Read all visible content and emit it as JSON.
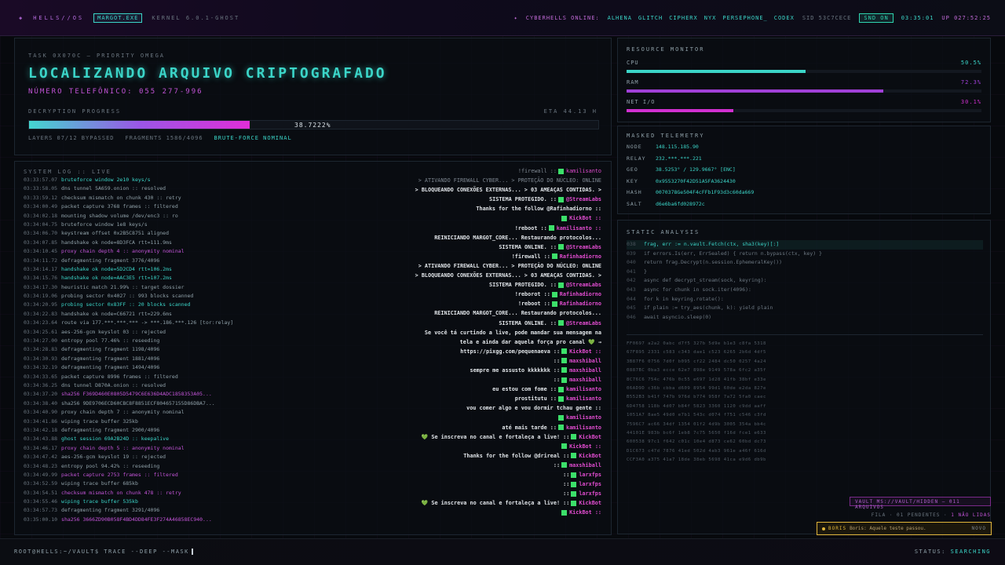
{
  "topbar": {
    "brand": "HELLS//OS",
    "proc": "MARGOT.EXE",
    "kernel": "KERNEL 6.0.1-GHOST",
    "online_label": "CYBERHELLS ONLINE:",
    "users": [
      "ALHENA",
      "GLITCH",
      "CIPHERX",
      "NYX",
      "PERSEPHONE_",
      "CODEX"
    ],
    "sid": "SID 53C7CECE",
    "snd": "SND ON",
    "clock": "03:35:01",
    "uptime": "UP 027:52:25"
  },
  "task": {
    "id": "TASK 0X070C — PRIORITY OMEGA",
    "title": "LOCALIZANDO ARQUIVO CRIPTOGRAFADO",
    "phone": "NÚMERO TELEFÔNICO: 055 277-996",
    "progress_label": "DECRYPTION PROGRESS",
    "eta": "ETA 44.13 H",
    "progress_pct": 38.7222,
    "progress_text": "38.7222%",
    "layers": "LAYERS 07/12 BYPASSED",
    "fragments": "FRAGMENTS 1586/4096",
    "bruteforce": "BRUTE-FORCE NOMINAL"
  },
  "log": {
    "title": "SYSTEM LOG :: LIVE",
    "lines": [
      {
        "t": "03:33:57.07",
        "m": "bruteforce window 2e10 keys/s",
        "c": "c"
      },
      {
        "t": "03:33:58.05",
        "m": "dns tunnel 5A659.onion :: resolved",
        "c": ""
      },
      {
        "t": "03:33:59.12",
        "m": "checksum mismatch on chunk 430 :: retry",
        "c": ""
      },
      {
        "t": "03:34:00.49",
        "m": "packet capture 3768 frames :: filtered",
        "c": ""
      },
      {
        "t": "03:34:02.18",
        "m": "mounting shadow volume /dev/enc3 :: ro",
        "c": ""
      },
      {
        "t": "03:34:04.75",
        "m": "bruteforce window 1e8 keys/s",
        "c": ""
      },
      {
        "t": "03:34:06.70",
        "m": "keystream offset 0x2B5C8751 aligned",
        "c": ""
      },
      {
        "t": "03:34:07.85",
        "m": "handshake ok node=8D3FCA rtt=111.9ms",
        "c": ""
      },
      {
        "t": "03:34:10.45",
        "m": "proxy chain depth 4 :: anonymity nominal",
        "c": "m"
      },
      {
        "t": "03:34:11.72",
        "m": "defragmenting fragment 3776/4096",
        "c": ""
      },
      {
        "t": "03:34:14.17",
        "m": "handshake ok node=5D2CD4 rtt=106.2ms",
        "c": "c"
      },
      {
        "t": "03:34:15.76",
        "m": "handshake ok node=AAC3E5 rtt=107.2ms",
        "c": "c"
      },
      {
        "t": "03:34:17.30",
        "m": "heuristic match 21.99% :: target dossier",
        "c": ""
      },
      {
        "t": "03:34:19.06",
        "m": "probing sector 0x4027 :: 993 blocks scanned",
        "c": ""
      },
      {
        "t": "03:34:20.95",
        "m": "probing sector 0x83FF :: 20 blocks scanned",
        "c": "c"
      },
      {
        "t": "03:34:22.83",
        "m": "handshake ok node=C66721 rtt=229.6ms",
        "c": ""
      },
      {
        "t": "03:34:23.64",
        "m": "route via 177.***.***.*** -> ***.186.***.126 [tor:relay]",
        "c": ""
      },
      {
        "t": "03:34:25.61",
        "m": "aes-256-gcm keyslot 03 :: rejected",
        "c": ""
      },
      {
        "t": "03:34:27.00",
        "m": "entropy pool 77.46% :: reseeding",
        "c": ""
      },
      {
        "t": "03:34:28.83",
        "m": "defragmenting fragment 1198/4096",
        "c": ""
      },
      {
        "t": "03:34:30.93",
        "m": "defragmenting fragment 1881/4096",
        "c": ""
      },
      {
        "t": "03:34:32.19",
        "m": "defragmenting fragment 1494/4096",
        "c": ""
      },
      {
        "t": "03:34:33.65",
        "m": "packet capture 8996 frames :: filtered",
        "c": ""
      },
      {
        "t": "03:34:36.25",
        "m": "dns tunnel D870A.onion :: resolved",
        "c": ""
      },
      {
        "t": "03:34:37.20",
        "m": "sha256 F369D460E0805D5479C6E636D4ADC1858353A05...",
        "c": "m"
      },
      {
        "t": "03:34:38.40",
        "m": "sha256 9DE9706ECD60CBC8F8851ECF804657155D86DBA7...",
        "c": ""
      },
      {
        "t": "03:34:40.90",
        "m": "proxy chain depth 7 :: anonymity nominal",
        "c": ""
      },
      {
        "t": "03:34:41.86",
        "m": "wiping trace buffer 325kb",
        "c": ""
      },
      {
        "t": "03:34:42.18",
        "m": "defragmenting fragment 2900/4096",
        "c": ""
      },
      {
        "t": "03:34:43.88",
        "m": "ghost session 69A2B24D :: keepalive",
        "c": "c"
      },
      {
        "t": "03:34:46.17",
        "m": "proxy chain depth 5 :: anonymity nominal",
        "c": "m"
      },
      {
        "t": "03:34:47.42",
        "m": "aes-256-gcm keyslot 19 :: rejected",
        "c": ""
      },
      {
        "t": "03:34:48.23",
        "m": "entropy pool 94.42% :: reseeding",
        "c": ""
      },
      {
        "t": "03:34:49.99",
        "m": "packet capture 2753 frames :: filtered",
        "c": "m"
      },
      {
        "t": "03:34:52.59",
        "m": "wiping trace buffer 685kb",
        "c": ""
      },
      {
        "t": "03:34:54.51",
        "m": "checksum mismatch on chunk 478 :: retry",
        "c": "m"
      },
      {
        "t": "03:34:55.46",
        "m": "wiping trace buffer 535kb",
        "c": "c"
      },
      {
        "t": "03:34:57.73",
        "m": "defragmenting fragment 3291/4096",
        "c": ""
      },
      {
        "t": "03:35:00.10",
        "m": "sha256 3666ZD90B058F4BD4DD84FE3F274A46858EC940...",
        "c": "m"
      }
    ]
  },
  "chat": [
    {
      "txt": "!firewall ::",
      "user": "kamilisanto",
      "cls": "dim"
    },
    {
      "txt": "> ATIVANDO FIREWALL CYBER... > PROTEÇÃO DO NÚCLEO: ONLINE",
      "user": "",
      "cls": "dim"
    },
    {
      "txt": "> BLOQUEANDO CONEXÕES EXTERNAS... > 03 AMEAÇAS CONTIDAS. >",
      "user": "",
      "cls": ""
    },
    {
      "txt": "SISTEMA PROTEGIDO. ::",
      "user": "@StreamLabs",
      "cls": ""
    },
    {
      "txt": "Thanks for the follow @Rafinhadiorno ::",
      "user": "",
      "cls": ""
    },
    {
      "txt": "",
      "user": "KickBot ::",
      "cls": ""
    },
    {
      "txt": "!reboot ::",
      "user": "kamilisanto ::",
      "cls": ""
    },
    {
      "txt": "REINICIANDO MARGOT_CORE... Restaurando protocolos...",
      "user": "",
      "cls": ""
    },
    {
      "txt": "SISTEMA ONLINE. ::",
      "user": "@StreamLabs",
      "cls": ""
    },
    {
      "txt": "!firewall ::",
      "user": "Rafinhadiorno",
      "cls": ""
    },
    {
      "txt": "> ATIVANDO FIREWALL CYBER... > PROTEÇÃO DO NÚCLEO: ONLINE",
      "user": "",
      "cls": ""
    },
    {
      "txt": "> BLOQUEANDO CONEXÕES EXTERNAS... > 03 AMEAÇAS CONTIDAS. >",
      "user": "",
      "cls": ""
    },
    {
      "txt": "SISTEMA PROTEGIDO. ::",
      "user": "@StreamLabs",
      "cls": ""
    },
    {
      "txt": "!reborot ::",
      "user": "Rafinhadiorno",
      "cls": ""
    },
    {
      "txt": "!reboot ::",
      "user": "Rafinhadiorno",
      "cls": ""
    },
    {
      "txt": "REINICIANDO MARGOT_CORE... Restaurando protocolos...",
      "user": "",
      "cls": ""
    },
    {
      "txt": "SISTEMA ONLINE. ::",
      "user": "@StreamLabs",
      "cls": ""
    },
    {
      "txt": "Se você tá curtindo a live, pode mandar sua mensagem na",
      "user": "",
      "cls": ""
    },
    {
      "txt": "tela e ainda dar aquela força pro canal 💚 →",
      "user": "",
      "cls": ""
    },
    {
      "txt": "https://pixgg.com/pequenaeva ::",
      "user": "KickBot ::",
      "cls": ""
    },
    {
      "txt": "::",
      "user": "maxshiball",
      "cls": ""
    },
    {
      "txt": "sempre me assusto kkkkkkk ::",
      "user": "maxshiball",
      "cls": ""
    },
    {
      "txt": "::",
      "user": "maxshiball",
      "cls": ""
    },
    {
      "txt": "eu estou com fome ::",
      "user": "kamilisanto",
      "cls": ""
    },
    {
      "txt": "prostitutu ::",
      "user": "kamilisanto",
      "cls": ""
    },
    {
      "txt": "vou comer algo e vou dormir tchau gente ::",
      "user": "",
      "cls": ""
    },
    {
      "txt": "",
      "user": "kamilisanto",
      "cls": ""
    },
    {
      "txt": "até mais tarde ::",
      "user": "kamilisanto",
      "cls": ""
    },
    {
      "txt": "💚 Se inscreva no canal e fortaleça a live! ::",
      "user": "KickBot",
      "cls": ""
    },
    {
      "txt": "",
      "user": "KickBot ::",
      "cls": ""
    },
    {
      "txt": "Thanks for the follow @drireal ::",
      "user": "KickBot",
      "cls": ""
    },
    {
      "txt": "::",
      "user": "maxshiball",
      "cls": ""
    },
    {
      "txt": "::",
      "user": "larxfps",
      "cls": ""
    },
    {
      "txt": "::",
      "user": "larxfps",
      "cls": ""
    },
    {
      "txt": "::",
      "user": "larxfps",
      "cls": ""
    },
    {
      "txt": "💚 Se inscreva no canal e fortaleça a live! ::",
      "user": "KickBot",
      "cls": ""
    },
    {
      "txt": "",
      "user": "KickBot ::",
      "cls": ""
    }
  ],
  "resource": {
    "title": "RESOURCE MONITOR",
    "cpu": {
      "label": "CPU",
      "value": "50.5%",
      "frac": 0.505,
      "color": "#3bd5c8"
    },
    "ram": {
      "label": "RAM",
      "value": "72.3%",
      "frac": 0.723,
      "color": "#a040d8"
    },
    "net": {
      "label": "NET I/O",
      "value": "30.1%",
      "frac": 0.301,
      "color": "#d030d0"
    }
  },
  "telemetry": {
    "title": "MASKED TELEMETRY",
    "rows": [
      [
        "NODE",
        "148.115.185.90"
      ],
      [
        "RELAY",
        "232.***.***.221"
      ],
      [
        "GEO",
        "38.5253° / 129.9667° [ENC]"
      ],
      [
        "KEY",
        "0x9553270F42D51A5FA3624430"
      ],
      [
        "HASH",
        "0070378Ge504F4cFFb1F93d3c60da669"
      ],
      [
        "SALT",
        "d6e6ba6fd028972c"
      ]
    ]
  },
  "static": {
    "title": "STATIC ANALYSIS",
    "code": [
      [
        "038",
        "frag, err := n.vault.Fetch(ctx, sha3(key)[:]"
      ],
      [
        "039",
        "if errors.Is(err, ErrSealed) { return n.bypass(ctx, key) }"
      ],
      [
        "040",
        "return frag.Decrypt(n.session.EphemeralKey())"
      ],
      [
        "041",
        "}"
      ],
      [
        "042",
        "async def decrypt_stream(sock, keyring):"
      ],
      [
        "043",
        "async for chunk in sock.iter(4096):"
      ],
      [
        "044",
        "for k in keyring.rotate():"
      ],
      [
        "045",
        "if plain := try_aes(chunk, k): yield plain"
      ],
      [
        "046",
        "await asyncio.sleep(0)"
      ]
    ],
    "hex": [
      "FF0697 a2a2 0abc d7f5 327b 5d9e b1e3 c8fa 5318",
      "67F895 2331 c583 c343 dae1 c523 6265 2b6d 4df5",
      "3B87F6 0756 7d0f b095 cf22 2484 dc50 0257 4a24",
      "0887BC 0ba3 ecce 62e7 898e 9149 578a 6fc2 a35f",
      "8C76C6 754c 476b 0c55 e697 1d28 41fb 38bf e33e",
      "06AD9D c36b cbba d609 8954 99d1 60de e2da 827e",
      "B552B3 b41f 747b 976d b774 958f 7a72 5fa0 caec",
      "6D4758 118b 4d07 b84f 5823 3360 1120 c9dd aaff",
      "1051A7 8ae5 49d0 e7b1 543c d074 f751 c546 c3fd",
      "7596C7 ac66 34df 1354 01f2 4d9b 3005 354a bb4c",
      "44101E 983b bc6f 1eb8 7c75 5650 f16d fce1 e633",
      "600538 97c1 f642 c01c 10e4 d873 ce62 60bd dc73",
      "D1C673 c47d 7876 41ed 502d 4ab3 961e a46f 616d",
      "CCF3A0 a375 41a7 18de 38eb 5698 41ca e9d6 db9b"
    ]
  },
  "vault": "VAULT MS://VAULT/HIDDEN — 011 ARQUIVOS",
  "fila": {
    "label": "FILA · 01 PENDENTES ·",
    "flag": "1 NÃO LIDAS"
  },
  "toast": {
    "name": "BORIS",
    "text": "Boris: Aquele teste passou.",
    "new": "NOVO"
  },
  "prompt": "ROOT@HELLS:~/VAULT$ TRACE --DEEP --MASK",
  "status": {
    "label": "STATUS:",
    "value": "SEARCHING"
  }
}
